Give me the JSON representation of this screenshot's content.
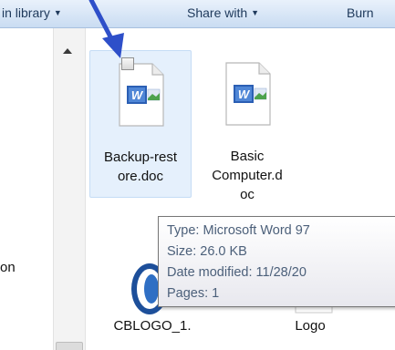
{
  "toolbar": {
    "include_in_library_label": "in library",
    "share_with_label": "Share with",
    "burn_label": "Burn"
  },
  "navigation": {
    "partial_label": "on"
  },
  "files": [
    {
      "name_line1": "Backup-rest",
      "name_line2": "ore.doc",
      "icon": "word-document-icon",
      "selected": true
    },
    {
      "name_line1": "Basic",
      "name_line2": "Computer.d",
      "name_line3": "oc",
      "icon": "word-document-icon",
      "selected": false
    },
    {
      "name": "CBLOGO_1.",
      "icon": "cblogo-image-icon"
    },
    {
      "name": "Logo",
      "icon": "image-file-icon"
    }
  ],
  "tooltip": {
    "type_line": "Type: Microsoft Word 97",
    "size_line": "Size: 26.0 KB",
    "date_line": "Date modified: 11/28/20",
    "pages_line": "Pages: 1"
  },
  "colors": {
    "annotation_arrow": "#2e4fc9",
    "selection_fill": "#e5f0fc",
    "word_blue": "#2b5fb4"
  }
}
